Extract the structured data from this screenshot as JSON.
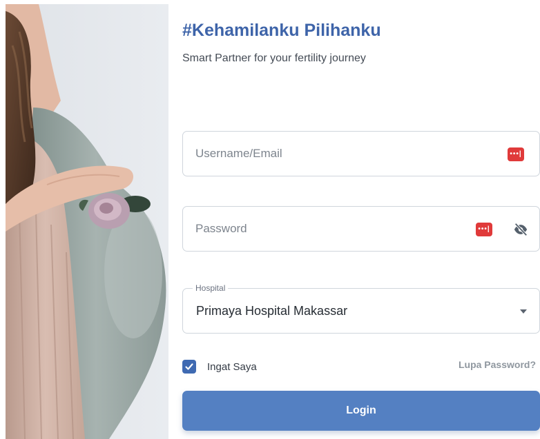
{
  "brand": {
    "title": "#Kehamilanku Pilihanku",
    "subtitle": "Smart Partner for your fertility journey"
  },
  "form": {
    "username": {
      "placeholder": "Username/Email",
      "value": ""
    },
    "password": {
      "placeholder": "Password",
      "value": ""
    },
    "hospital": {
      "label": "Hospital",
      "selected": "Primaya Hospital Makassar"
    },
    "remember": {
      "label": "Ingat Saya",
      "checked": true
    },
    "forgot_label": "Lupa Password?",
    "login_label": "Login"
  },
  "icons": {
    "password_manager": "password-manager-icon",
    "visibility": "eye-off-icon",
    "dropdown": "caret-down-icon",
    "checkbox": "check-icon"
  },
  "colors": {
    "brand_blue": "#3e64a9",
    "button_blue": "#5480c2",
    "checkbox_blue": "#3f6ab2",
    "password_manager_red": "#e03a3a",
    "muted_text": "#8f979f"
  }
}
